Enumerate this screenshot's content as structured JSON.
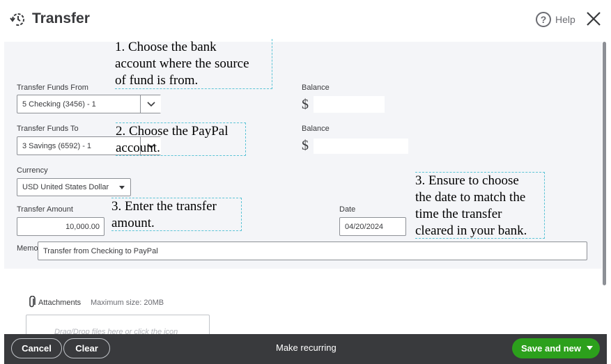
{
  "header": {
    "title": "Transfer",
    "help_label": "Help"
  },
  "form": {
    "from_label": "Transfer Funds From",
    "from_value": "5 Checking (3456) - 1",
    "to_label": "Transfer Funds To",
    "to_value": "3 Savings (6592) - 1",
    "balance_label_1": "Balance",
    "balance_label_2": "Balance",
    "dollar_1": "$",
    "dollar_2": "$",
    "currency_label": "Currency",
    "currency_value": "USD United States Dollar",
    "amount_label": "Transfer Amount",
    "amount_value": "10,000.00",
    "date_label": "Date",
    "date_value": "04/20/2024",
    "memo_label": "Memo",
    "memo_value": "Transfer from Checking to PayPal"
  },
  "annotations": {
    "note1": "1. Choose the bank\naccount where the source\nof fund is from.",
    "note2": "2. Choose the PayPal\naccount.",
    "note3": "3. Enter the transfer\namount.",
    "note4": "3. Ensure to choose\nthe date to match the\ntime the transfer\ncleared in your bank."
  },
  "attachments": {
    "label": "Attachments",
    "max_size": "Maximum size: 20MB",
    "dropzone_text": "Drag/Drop files here or click the icon"
  },
  "footer": {
    "cancel": "Cancel",
    "clear": "Clear",
    "recurring": "Make recurring",
    "save": "Save and new"
  },
  "colors": {
    "accent_green": "#2ca01c",
    "footer_bg": "#393a3d",
    "annotation_border": "#5cc4d6"
  },
  "icons": [
    "transfer-icon",
    "help-icon",
    "close-icon",
    "chevron-down-icon",
    "caret-down-icon",
    "paperclip-icon"
  ]
}
